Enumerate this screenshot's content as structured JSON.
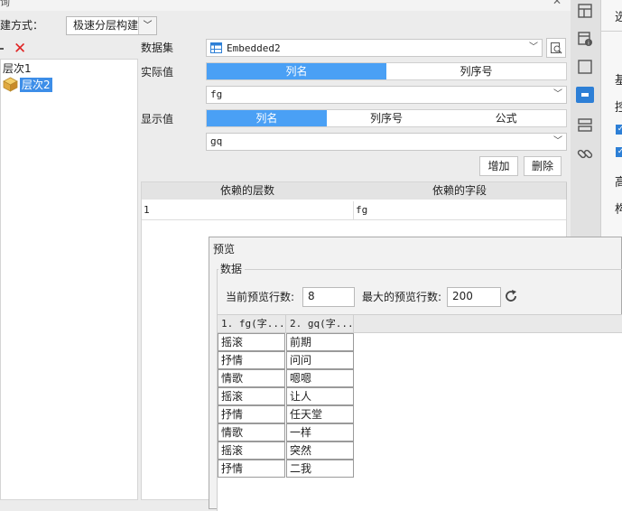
{
  "window": {
    "title_fragment": "询"
  },
  "build": {
    "label": "建方式：",
    "value": "极速分层构建"
  },
  "tree": {
    "remove_symbol": "✕",
    "items": [
      {
        "label": "层次1"
      },
      {
        "label": "层次2"
      }
    ]
  },
  "dataset": {
    "label": "数据集",
    "value": "Embedded2"
  },
  "actual": {
    "label": "实际值",
    "tabs": [
      "列名",
      "列序号"
    ],
    "value": "fg"
  },
  "display": {
    "label": "显示值",
    "tabs": [
      "列名",
      "列序号",
      "公式"
    ],
    "value": "gq"
  },
  "buttons": {
    "add": "增加",
    "delete": "删除"
  },
  "dep_table": {
    "headers": [
      "依赖的层数",
      "依赖的字段"
    ],
    "rows": [
      [
        "1",
        "fg"
      ]
    ]
  },
  "right_panel": {
    "items": [
      "选",
      "基",
      "控",
      "高",
      "构"
    ]
  },
  "preview": {
    "title": "预览",
    "group": "数据",
    "current_rows_label": "当前预览行数:",
    "current_rows": "8",
    "max_rows_label": "最大的预览行数:",
    "max_rows": "200",
    "columns": [
      "1. fg(字...",
      "2. gq(字..."
    ],
    "rows": [
      [
        "摇滚",
        "前期"
      ],
      [
        "抒情",
        "问问"
      ],
      [
        "情歌",
        "嗯嗯"
      ],
      [
        "摇滚",
        "让人"
      ],
      [
        "抒情",
        "任天堂"
      ],
      [
        "情歌",
        "一样"
      ],
      [
        "摇滚",
        "突然"
      ],
      [
        "抒情",
        "二我"
      ]
    ]
  },
  "colors": {
    "accent": "#4aa0f5",
    "selected_tree": "#3d8ee8"
  }
}
